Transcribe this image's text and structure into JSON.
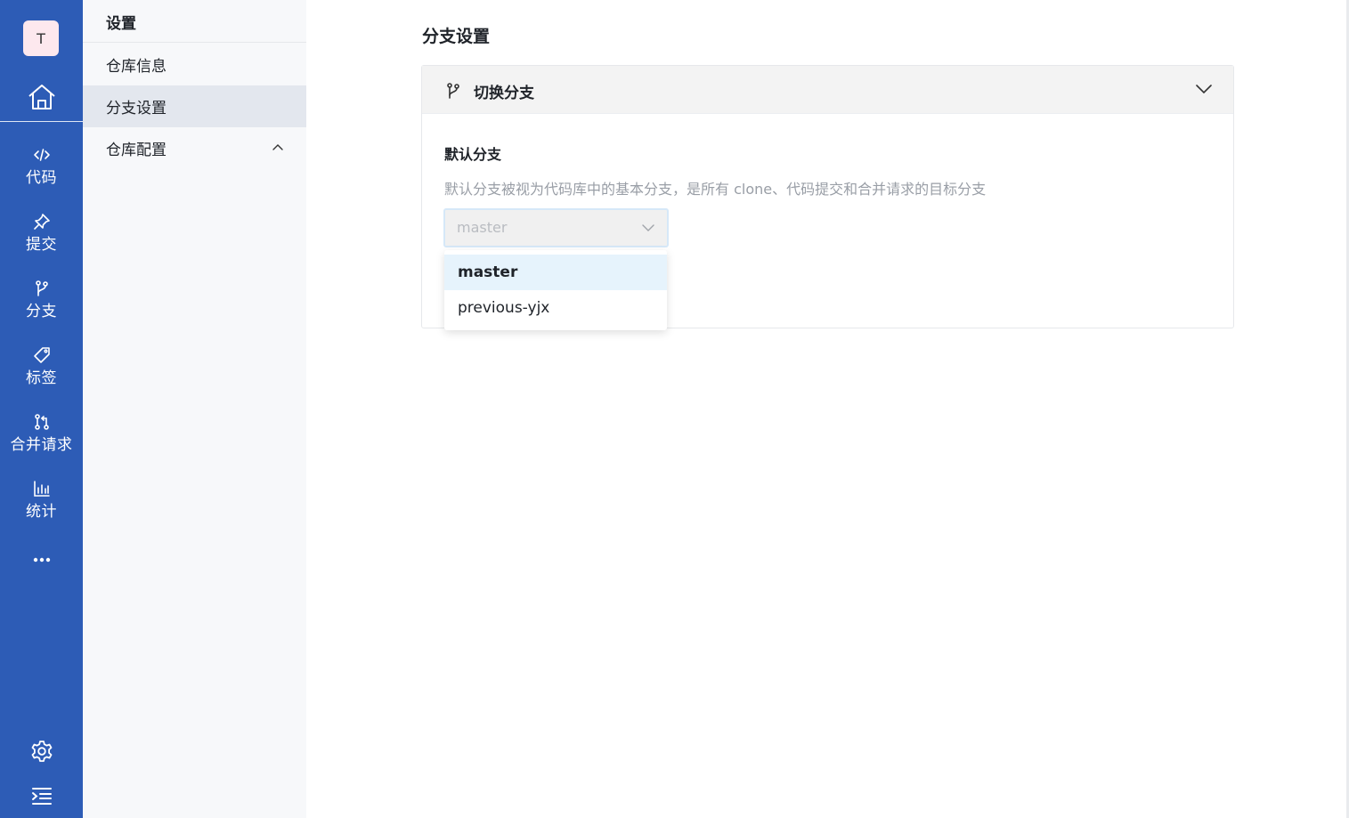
{
  "rail": {
    "avatar_letter": "T",
    "items": [
      {
        "label": "代码",
        "icon": "code-icon"
      },
      {
        "label": "提交",
        "icon": "pin-icon"
      },
      {
        "label": "分支",
        "icon": "branch-icon"
      },
      {
        "label": "标签",
        "icon": "tag-icon"
      },
      {
        "label": "合并请求",
        "icon": "merge-request-icon"
      },
      {
        "label": "统计",
        "icon": "bar-chart-icon"
      }
    ],
    "bg_color": "#2d5cb6"
  },
  "subnav": {
    "title": "设置",
    "items": [
      {
        "label": "仓库信息"
      },
      {
        "label": "分支设置"
      },
      {
        "label": "仓库配置"
      }
    ]
  },
  "main": {
    "page_title": "分支设置",
    "panel": {
      "header": "切换分支",
      "field_label": "默认分支",
      "description": "默认分支被视为代码库中的基本分支，是所有 clone、代码提交和合并请求的目标分支",
      "select_value": "master",
      "options": [
        "master",
        "previous-yjx"
      ]
    }
  }
}
